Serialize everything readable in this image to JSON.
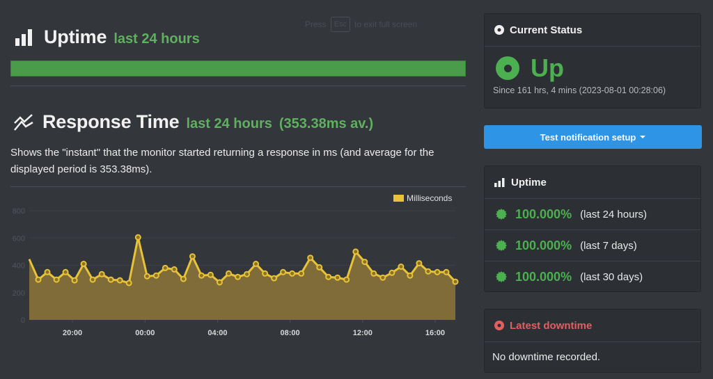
{
  "fullscreen_hint": {
    "prefix": "Press",
    "key": "Esc",
    "suffix": "to exit full screen"
  },
  "uptime_section": {
    "icon": "bar-chart-icon",
    "title": "Uptime",
    "period": "last 24 hours",
    "bar_percent": 100,
    "bar_color": "#4a9c4a"
  },
  "response_section": {
    "icon": "line-chart-icon",
    "title": "Response Time",
    "period": "last 24 hours",
    "average": "(353.38ms av.)",
    "description": "Shows the \"instant\" that the monitor started returning a response in ms (and average for the displayed period is 353.38ms)."
  },
  "chart_data": {
    "type": "area",
    "title": "",
    "xlabel": "",
    "ylabel": "",
    "ylim": [
      0,
      800
    ],
    "yticks": [
      "0",
      "200",
      "400",
      "600",
      "800"
    ],
    "xticks": [
      "20:00",
      "00:00",
      "04:00",
      "08:00",
      "12:00",
      "16:00"
    ],
    "grid": true,
    "legend": {
      "position": "top-right",
      "entries": [
        "Milliseconds"
      ]
    },
    "series_color": "#e8c33a",
    "fill_color": "#7f6c38",
    "series": [
      {
        "name": "Milliseconds",
        "values": [
          445,
          295,
          350,
          295,
          350,
          290,
          410,
          295,
          335,
          295,
          290,
          270,
          605,
          320,
          325,
          380,
          370,
          300,
          465,
          325,
          330,
          275,
          340,
          315,
          335,
          410,
          340,
          305,
          350,
          340,
          340,
          455,
          385,
          315,
          310,
          295,
          500,
          425,
          340,
          310,
          345,
          390,
          325,
          415,
          355,
          350,
          350,
          280
        ]
      }
    ]
  },
  "current_status": {
    "title": "Current Status",
    "state": "Up",
    "since": "Since 161 hrs, 4 mins (2023-08-01 00:28:06)",
    "color": "#4caf50"
  },
  "notify_button": {
    "label": "Test notification setup"
  },
  "uptime_panel": {
    "title": "Uptime",
    "rows": [
      {
        "percent": "100.000%",
        "period": "(last 24 hours)"
      },
      {
        "percent": "100.000%",
        "period": "(last 7 days)"
      },
      {
        "percent": "100.000%",
        "period": "(last 30 days)"
      }
    ]
  },
  "downtime_panel": {
    "title": "Latest downtime",
    "message": "No downtime recorded.",
    "color": "#e35f5f"
  }
}
